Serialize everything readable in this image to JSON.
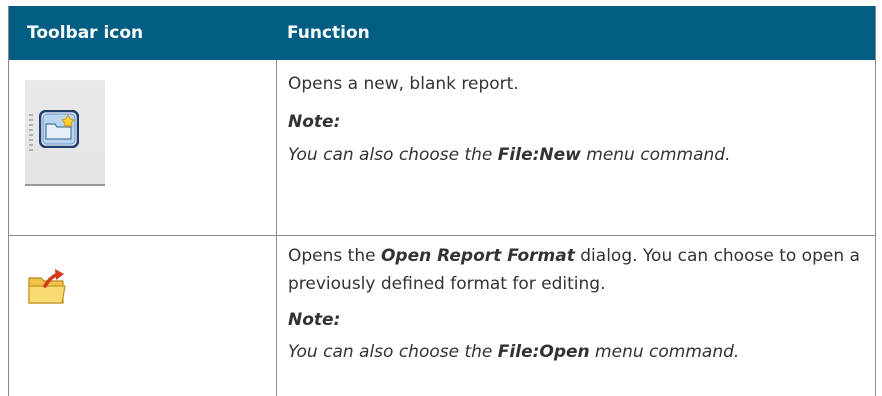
{
  "table": {
    "header": {
      "col1": "Toolbar icon",
      "col2": "Function"
    },
    "rows": [
      {
        "icon": "new-report-icon",
        "text": "Opens a new, blank report.",
        "note_label": "Note:",
        "note_pre": "You can also choose the ",
        "note_cmd": "File:New",
        "note_post": " menu command."
      },
      {
        "icon": "open-folder-icon",
        "text_pre": "Opens the ",
        "text_em": "Open Report Format",
        "text_post": " dialog. You can choose to open a previously defined format for editing.",
        "note_label": "Note:",
        "note_pre": "You can also choose the ",
        "note_cmd": "File:Open",
        "note_post": " menu command."
      }
    ]
  },
  "colors": {
    "header_bg": "#005e85",
    "header_text": "#ffffff",
    "body_text": "#333333"
  }
}
